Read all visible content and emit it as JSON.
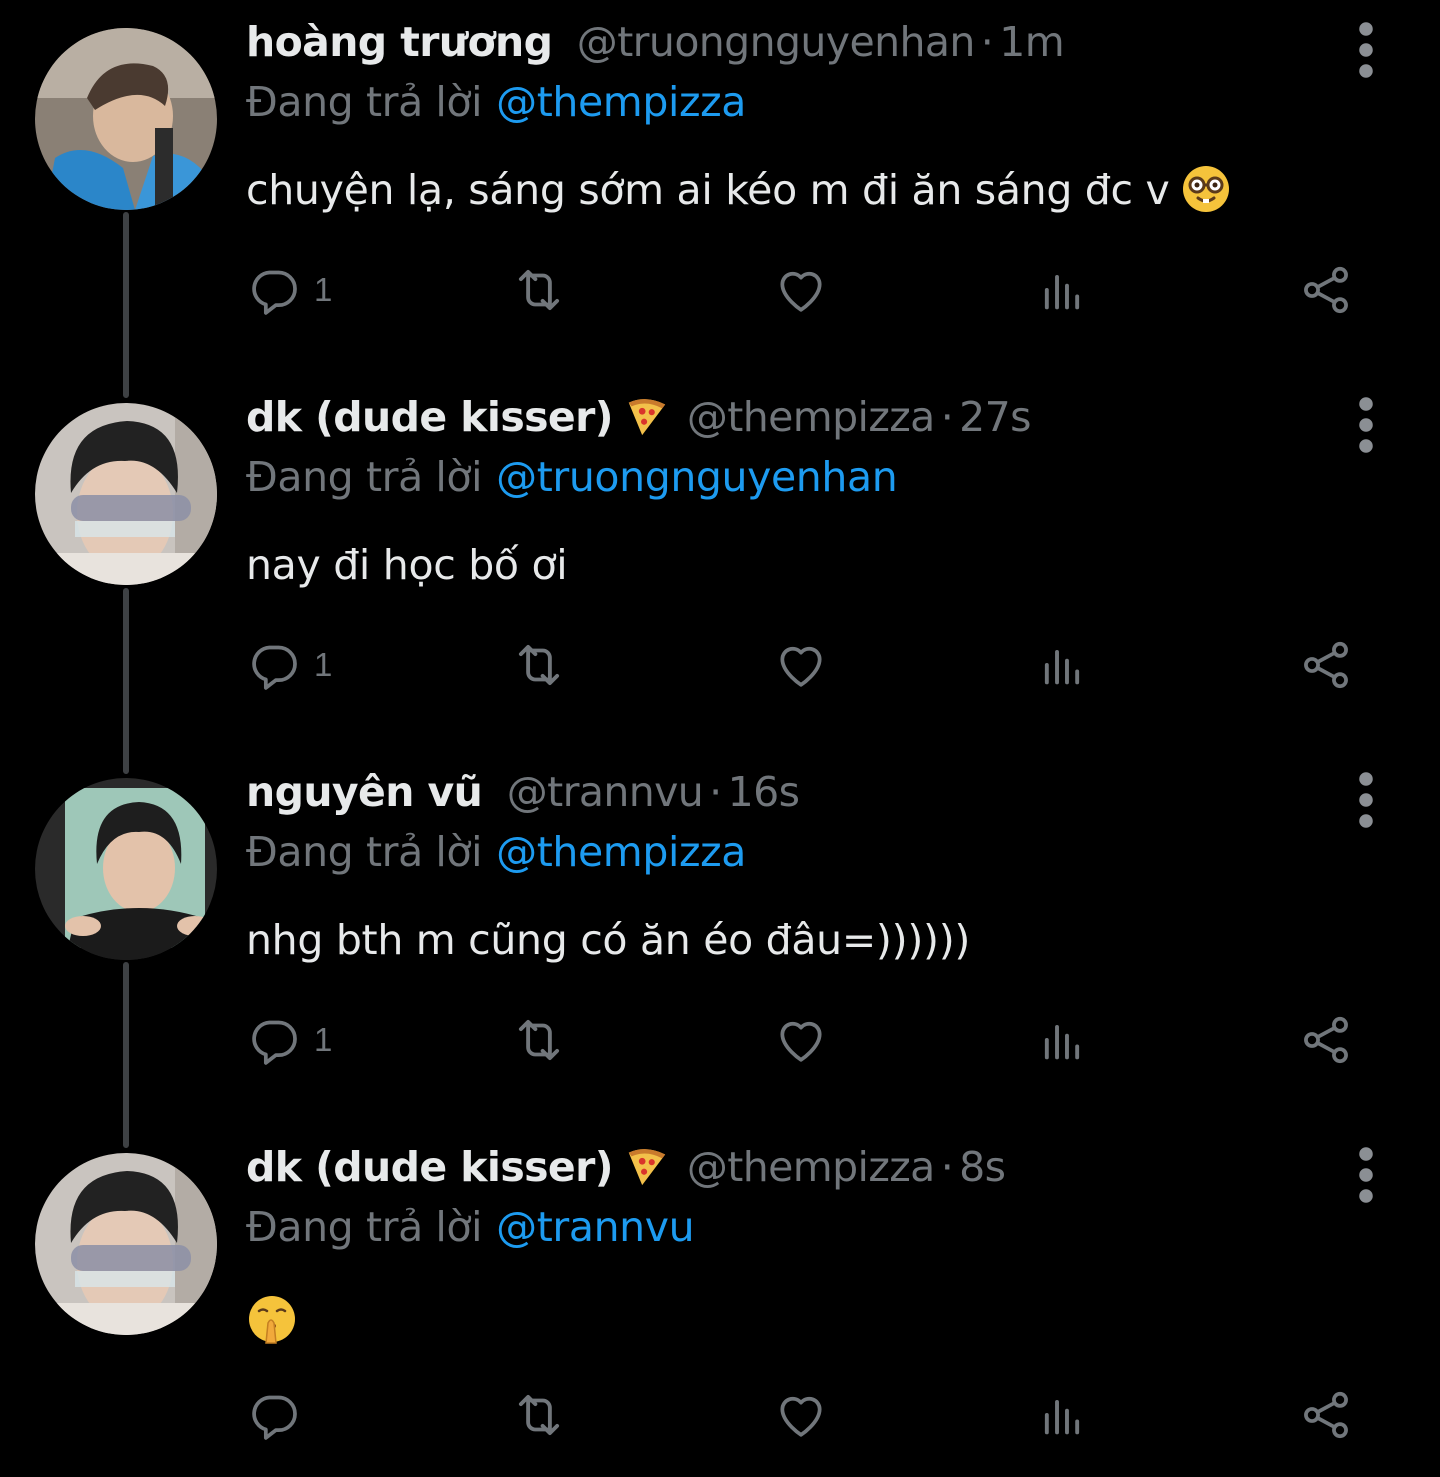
{
  "thread": [
    {
      "display_name": "hoàng trương",
      "badge_icon": "",
      "handle": "@truongnguyenhan",
      "separator": "·",
      "time": "1m",
      "reply_prefix": "Đang trả lời",
      "reply_to": "@thempizza",
      "text": "chuyện lạ, sáng sớm ai kéo m đi ăn sáng đc v",
      "text_emoji": "nerd-face",
      "reply_count": "1"
    },
    {
      "display_name": "dk (dude kisser)",
      "badge_icon": "pizza-icon",
      "handle": "@thempizza",
      "separator": "·",
      "time": "27s",
      "reply_prefix": "Đang trả lời",
      "reply_to": "@truongnguyenhan",
      "text": "nay đi học bố ơi",
      "text_emoji": "",
      "reply_count": "1"
    },
    {
      "display_name": "nguyên vũ",
      "badge_icon": "",
      "handle": "@trannvu",
      "separator": "·",
      "time": "16s",
      "reply_prefix": "Đang trả lời",
      "reply_to": "@thempizza",
      "text": "nhg bth m cũng có ăn éo đâu=))))))",
      "text_emoji": "",
      "reply_count": "1"
    },
    {
      "display_name": "dk (dude kisser)",
      "badge_icon": "pizza-icon",
      "handle": "@thempizza",
      "separator": "·",
      "time": "8s",
      "reply_prefix": "Đang trả lời",
      "reply_to": "@trannvu",
      "text": "",
      "text_emoji": "shushing-face",
      "reply_count": ""
    }
  ],
  "colors": {
    "background": "#000000",
    "text": "#e7e9ea",
    "muted": "#71767b",
    "link": "#1d9bf0",
    "thread_line": "#3e4144"
  },
  "icons": {
    "reply": "reply-icon",
    "retweet": "retweet-icon",
    "like": "heart-icon",
    "views": "views-icon",
    "share": "share-icon",
    "more": "more-vertical-icon"
  }
}
